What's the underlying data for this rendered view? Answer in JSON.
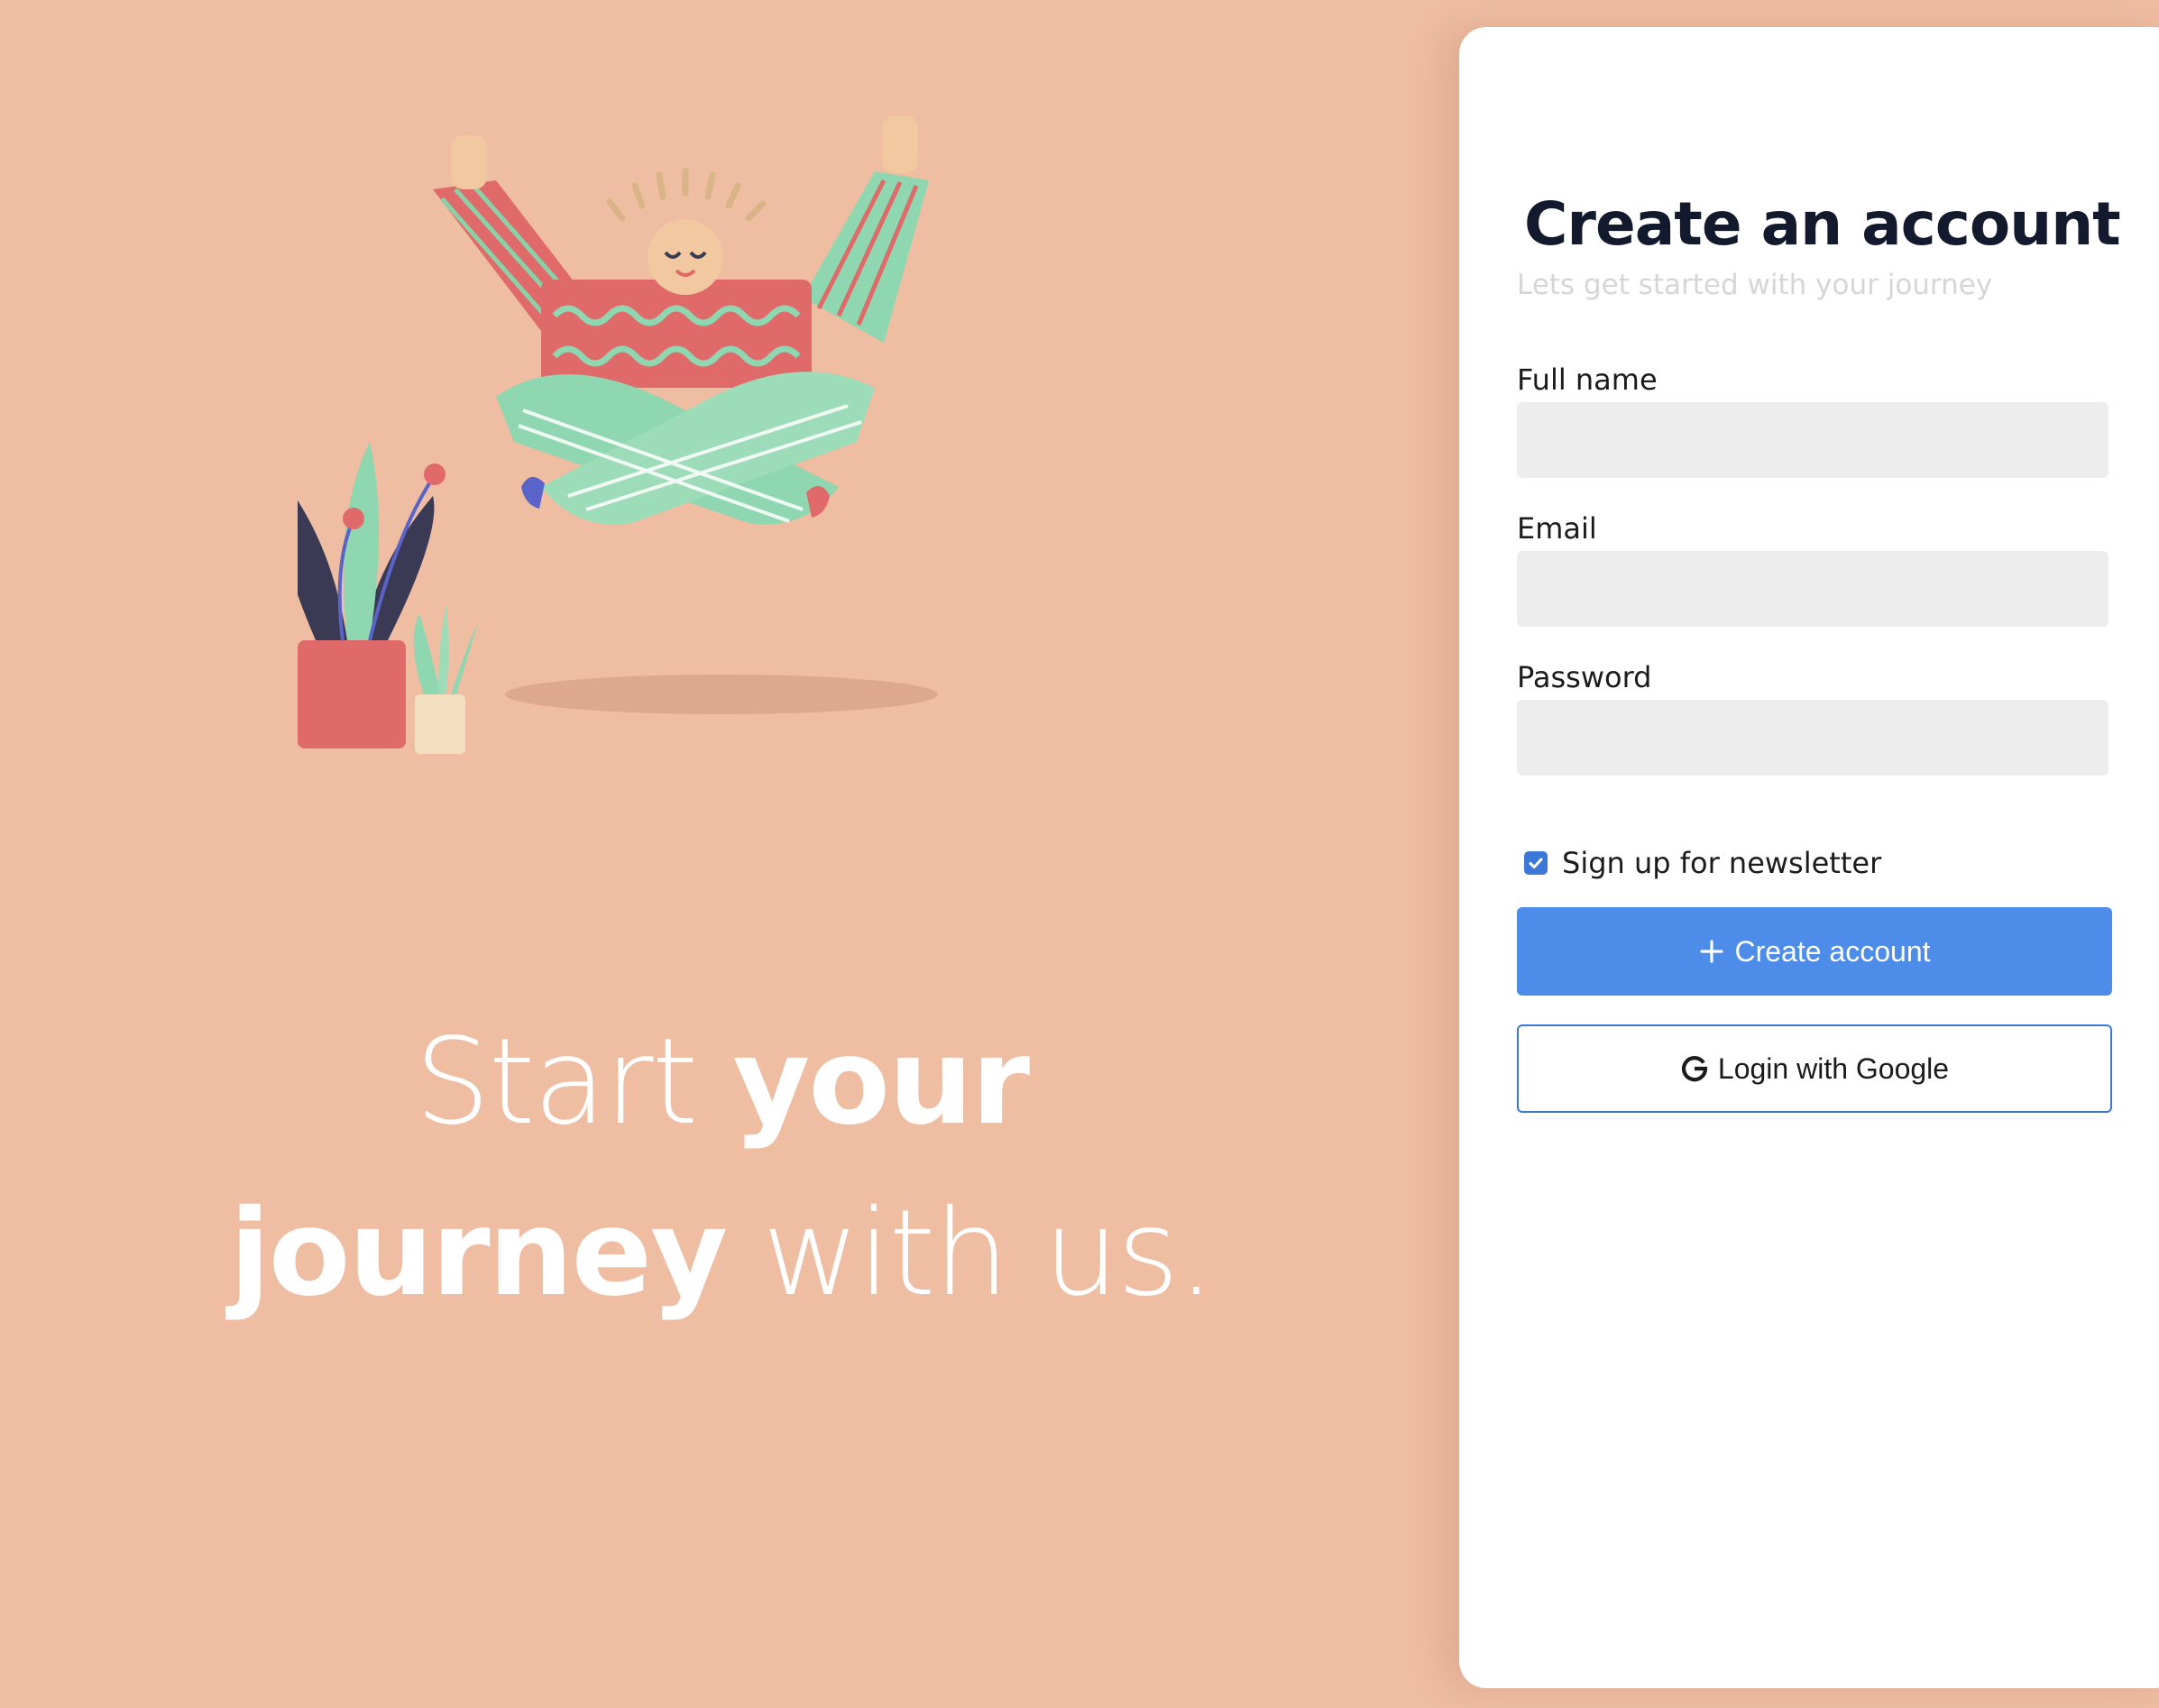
{
  "hero": {
    "headline_line1_light": "Start ",
    "headline_line1_bold": "your",
    "headline_line2_bold": "journey",
    "headline_line2_light": " with us."
  },
  "signup": {
    "title": "Create an account",
    "subtitle": "Lets get started with your journey",
    "fields": {
      "full_name": {
        "label": "Full name",
        "value": "",
        "placeholder": ""
      },
      "email": {
        "label": "Email",
        "value": "",
        "placeholder": ""
      },
      "password": {
        "label": "Password",
        "value": "",
        "placeholder": ""
      }
    },
    "newsletter": {
      "label": "Sign up for newsletter",
      "checked": true
    },
    "create_button": {
      "icon": "plus-icon",
      "label": "Create account"
    },
    "google_button": {
      "icon": "google-icon",
      "label": "Login with Google"
    }
  },
  "colors": {
    "background": "#efbda2",
    "card": "#ffffff",
    "title": "#131a2e",
    "subtitle": "#d6d6d6",
    "input_bg": "#ededed",
    "primary": "#4d8ce8",
    "outline_border": "#3b78d8"
  }
}
